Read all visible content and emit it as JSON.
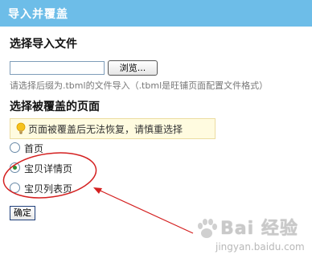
{
  "window": {
    "title": "导入并覆盖"
  },
  "import_section": {
    "heading": "选择导入文件",
    "file_value": "",
    "browse_label": "浏览...",
    "hint": "请选择后缀为.tbml的文件导入（.tbml是旺铺页面配置文件格式）"
  },
  "override_section": {
    "heading": "选择被覆盖的页面",
    "notice": "页面被覆盖后无法恢复，请慎重选择",
    "options": [
      {
        "label": "首页",
        "checked": false
      },
      {
        "label": "宝贝详情页",
        "checked": true
      },
      {
        "label": "宝贝列表页",
        "checked": false
      }
    ]
  },
  "confirm_label": "确定",
  "watermark": {
    "brand": "Bai 经验",
    "url": "jingyan.baidu.com"
  },
  "colors": {
    "title_bar": "#6dbde8",
    "annotation": "#d42020"
  },
  "icons": [
    "bulb-icon",
    "paw-icon"
  ]
}
